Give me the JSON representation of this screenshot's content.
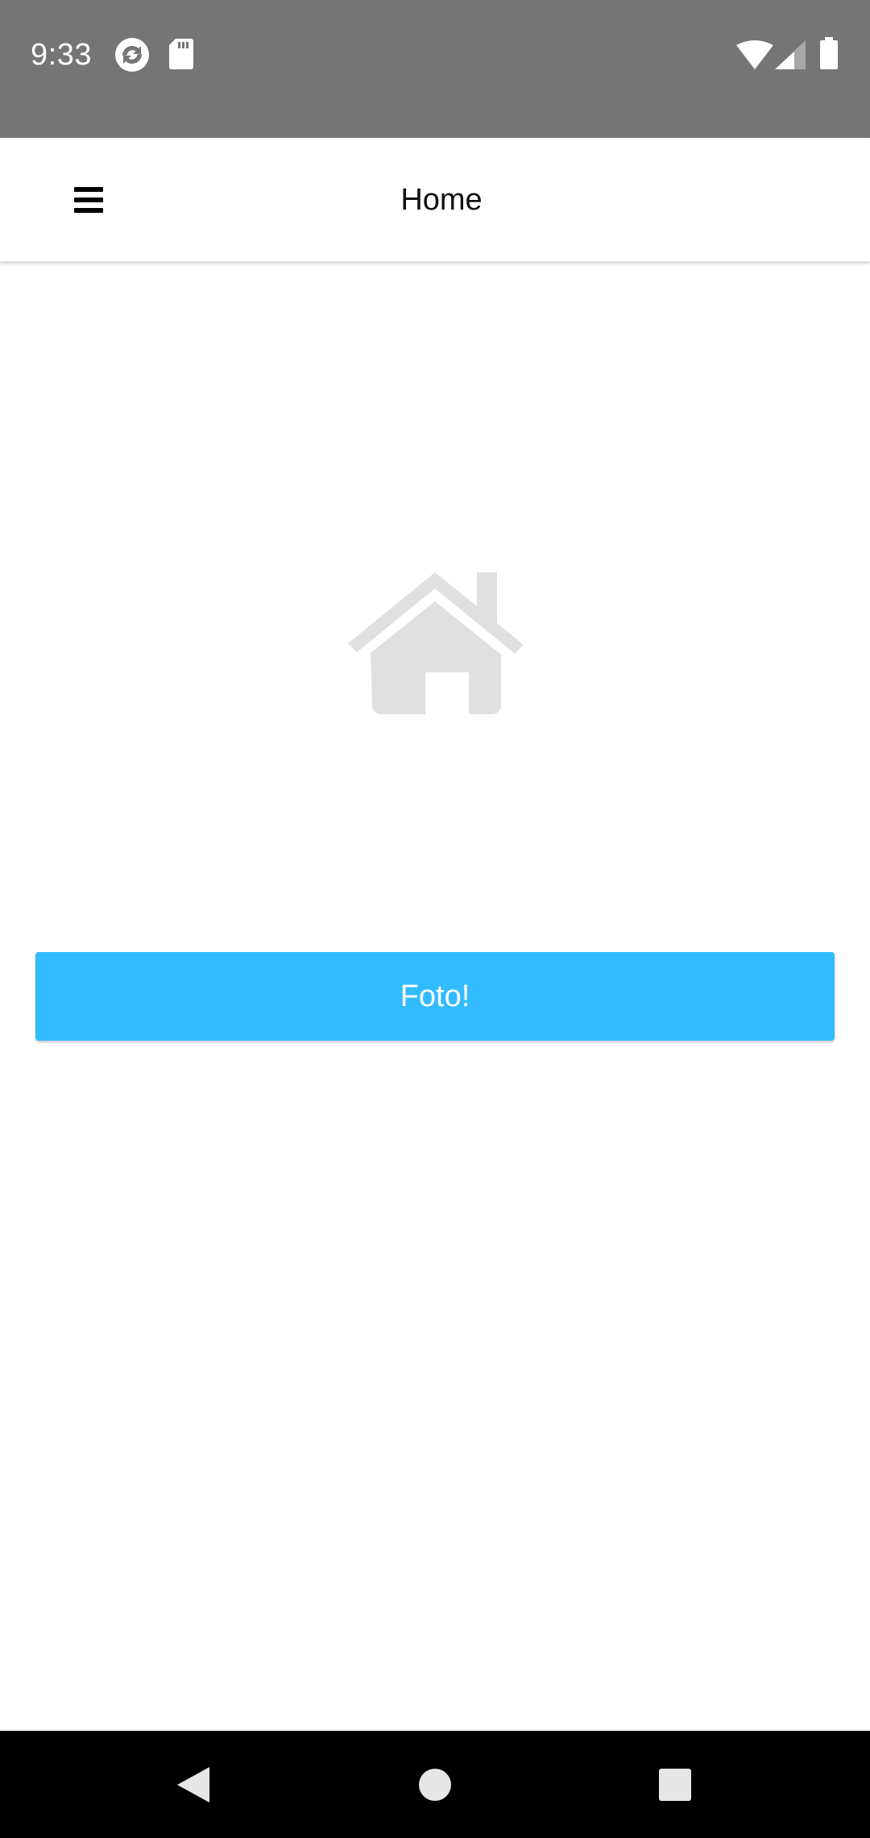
{
  "status_bar": {
    "time": "9:33",
    "icons": [
      "sync-icon",
      "sd-card-icon",
      "wifi-icon",
      "signal-icon",
      "battery-icon"
    ],
    "background": "#757575"
  },
  "app_bar": {
    "title": "Home",
    "menu_icon": "hamburger-menu-icon"
  },
  "main": {
    "illustration_icon": "home-icon",
    "illustration_color": "#e0e0e0",
    "photo_button_label": "Foto!",
    "photo_button_color": "#33bbff"
  },
  "nav_bar": {
    "buttons": [
      "back-icon",
      "home-circle-icon",
      "recents-icon"
    ]
  }
}
